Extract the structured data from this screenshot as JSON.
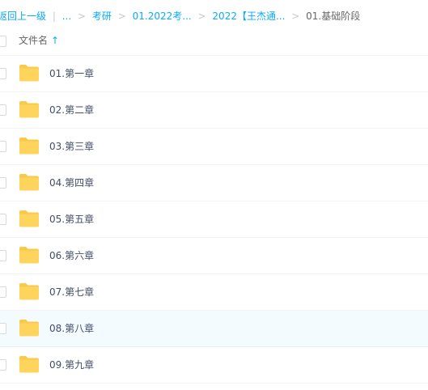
{
  "breadcrumb": {
    "back": "返回上一级",
    "separator_pipe": "|",
    "ellipsis": "...",
    "items": [
      "考研",
      "01.2022考...",
      "2022【王杰通..."
    ],
    "current": "01.基础阶段",
    "link_color": "#09aaff"
  },
  "header": {
    "column_label": "文件名",
    "sort_icon": "arrow-up-icon",
    "sort_glyph": "↑"
  },
  "files": [
    {
      "name": "01.第一章",
      "icon": "folder-icon"
    },
    {
      "name": "02.第二章",
      "icon": "folder-icon"
    },
    {
      "name": "03.第三章",
      "icon": "folder-icon"
    },
    {
      "name": "04.第四章",
      "icon": "folder-icon"
    },
    {
      "name": "05.第五章",
      "icon": "folder-icon"
    },
    {
      "name": "06.第六章",
      "icon": "folder-icon"
    },
    {
      "name": "07.第七章",
      "icon": "folder-icon"
    },
    {
      "name": "08.第八章",
      "icon": "folder-icon",
      "hovered": true
    },
    {
      "name": "09.第九章",
      "icon": "folder-icon"
    }
  ],
  "colors": {
    "folder": "#ffd45c",
    "folder_tab": "#f9c94a",
    "hover_row": "#f4fbff"
  }
}
